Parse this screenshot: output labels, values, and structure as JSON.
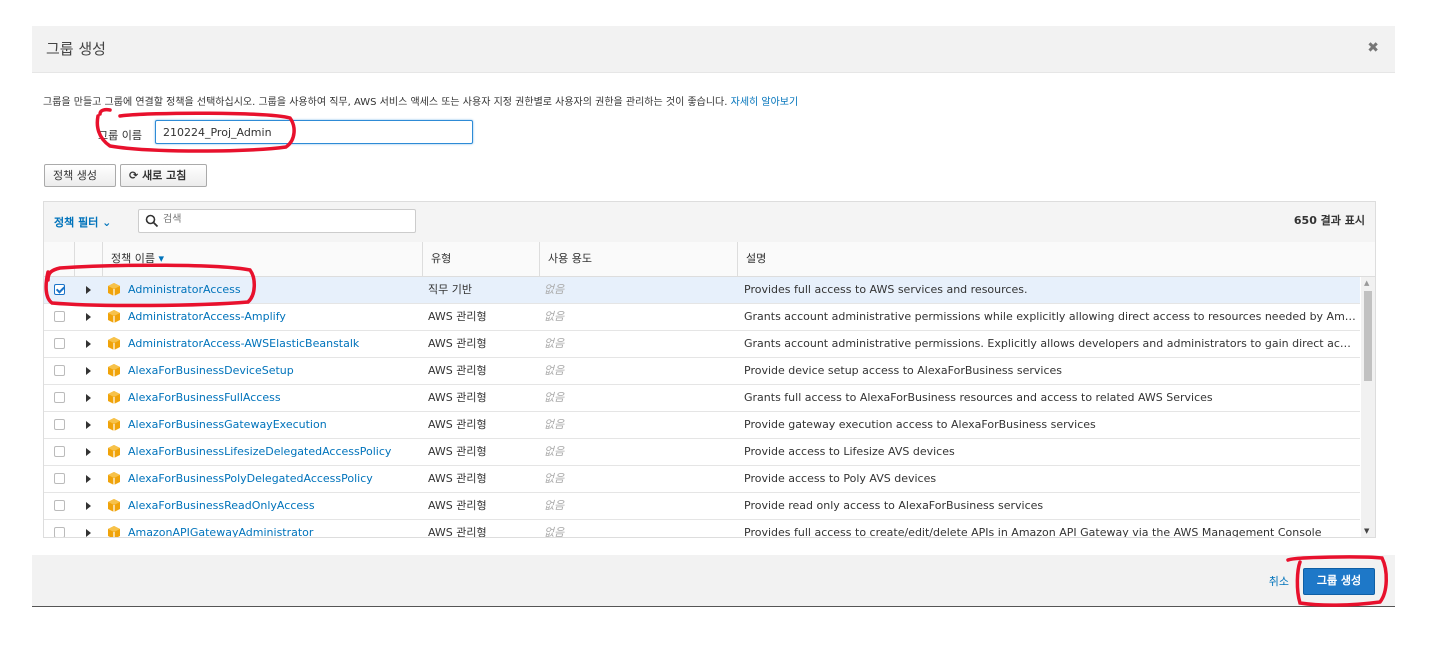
{
  "dialog": {
    "title": "그룹 생성",
    "close_icon": "close-icon"
  },
  "intro": {
    "text": "그룹을 만들고 그룹에 연결할 정책을 선택하십시오. 그룹을 사용하여 직무, AWS 서비스 액세스 또는 사용자 지정 권한별로 사용자의 권한을 관리하는 것이 좋습니다. ",
    "link": "자세히 알아보기"
  },
  "group_name": {
    "label": "그룹 이름",
    "value": "210224_Proj_Admin"
  },
  "toolbar": {
    "create_policy": "정책 생성",
    "refresh": "새로 고침",
    "refresh_icon": "refresh-icon"
  },
  "filter": {
    "label": "정책 필터",
    "search_placeholder": "검색",
    "results": "650 결과 표시"
  },
  "columns": {
    "name": "정책 이름",
    "type": "유형",
    "usage": "사용 용도",
    "description": "설명"
  },
  "rows": [
    {
      "name": "AdministratorAccess",
      "type": "직무 기반",
      "usage": "없음",
      "description": "Provides full access to AWS services and resources.",
      "checked": true
    },
    {
      "name": "AdministratorAccess-Amplify",
      "type": "AWS 관리형",
      "usage": "없음",
      "description": "Grants account administrative permissions while explicitly allowing direct access to resources needed by Amplify applicat...",
      "checked": false
    },
    {
      "name": "AdministratorAccess-AWSElasticBeanstalk",
      "type": "AWS 관리형",
      "usage": "없음",
      "description": "Grants account administrative permissions. Explicitly allows developers and administrators to gain direct access to resou...",
      "checked": false
    },
    {
      "name": "AlexaForBusinessDeviceSetup",
      "type": "AWS 관리형",
      "usage": "없음",
      "description": "Provide device setup access to AlexaForBusiness services",
      "checked": false
    },
    {
      "name": "AlexaForBusinessFullAccess",
      "type": "AWS 관리형",
      "usage": "없음",
      "description": "Grants full access to AlexaForBusiness resources and access to related AWS Services",
      "checked": false
    },
    {
      "name": "AlexaForBusinessGatewayExecution",
      "type": "AWS 관리형",
      "usage": "없음",
      "description": "Provide gateway execution access to AlexaForBusiness services",
      "checked": false
    },
    {
      "name": "AlexaForBusinessLifesizeDelegatedAccessPolicy",
      "type": "AWS 관리형",
      "usage": "없음",
      "description": "Provide access to Lifesize AVS devices",
      "checked": false
    },
    {
      "name": "AlexaForBusinessPolyDelegatedAccessPolicy",
      "type": "AWS 관리형",
      "usage": "없음",
      "description": "Provide access to Poly AVS devices",
      "checked": false
    },
    {
      "name": "AlexaForBusinessReadOnlyAccess",
      "type": "AWS 관리형",
      "usage": "없음",
      "description": "Provide read only access to AlexaForBusiness services",
      "checked": false
    },
    {
      "name": "AmazonAPIGatewayAdministrator",
      "type": "AWS 관리형",
      "usage": "없음",
      "description": "Provides full access to create/edit/delete APIs in Amazon API Gateway via the AWS Management Console",
      "checked": false
    }
  ],
  "footer": {
    "cancel": "취소",
    "create": "그룹 생성"
  },
  "colors": {
    "link": "#0073bb",
    "primary": "#1e78c8",
    "annotation": "#e8112d"
  }
}
